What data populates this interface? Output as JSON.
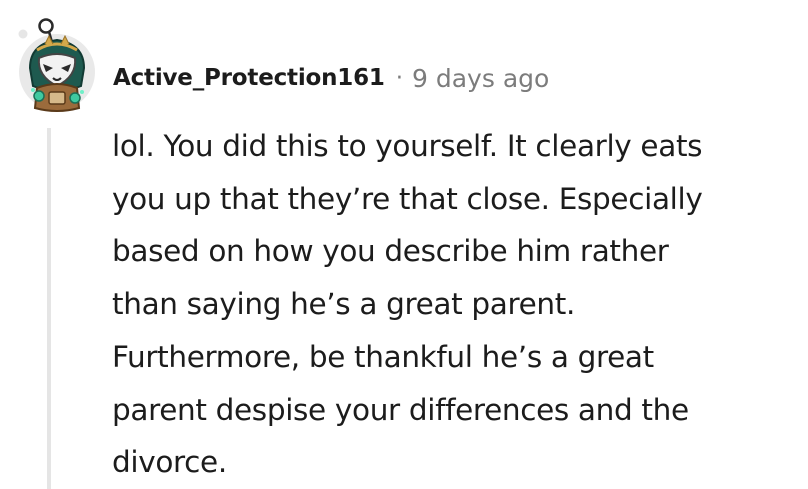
{
  "comment": {
    "author": "Active_Protection161",
    "separator": "·",
    "timestamp": "9 days ago",
    "avatar_icon": "snoo-avatar-icon",
    "body_lines": [
      "lol. You did this to yourself. It clearly eats",
      "you up that they’re that close. Especially",
      "based on how you describe him rather",
      "than saying he’s a great parent.",
      "Furthermore, be thankful he’s a great",
      "parent despise your differences and the",
      "divorce."
    ]
  },
  "colors": {
    "text": "#1c1c1c",
    "meta": "#7c7c7c",
    "thread_line": "#e5e5e5",
    "avatar_bg": "#e9e9e9"
  }
}
